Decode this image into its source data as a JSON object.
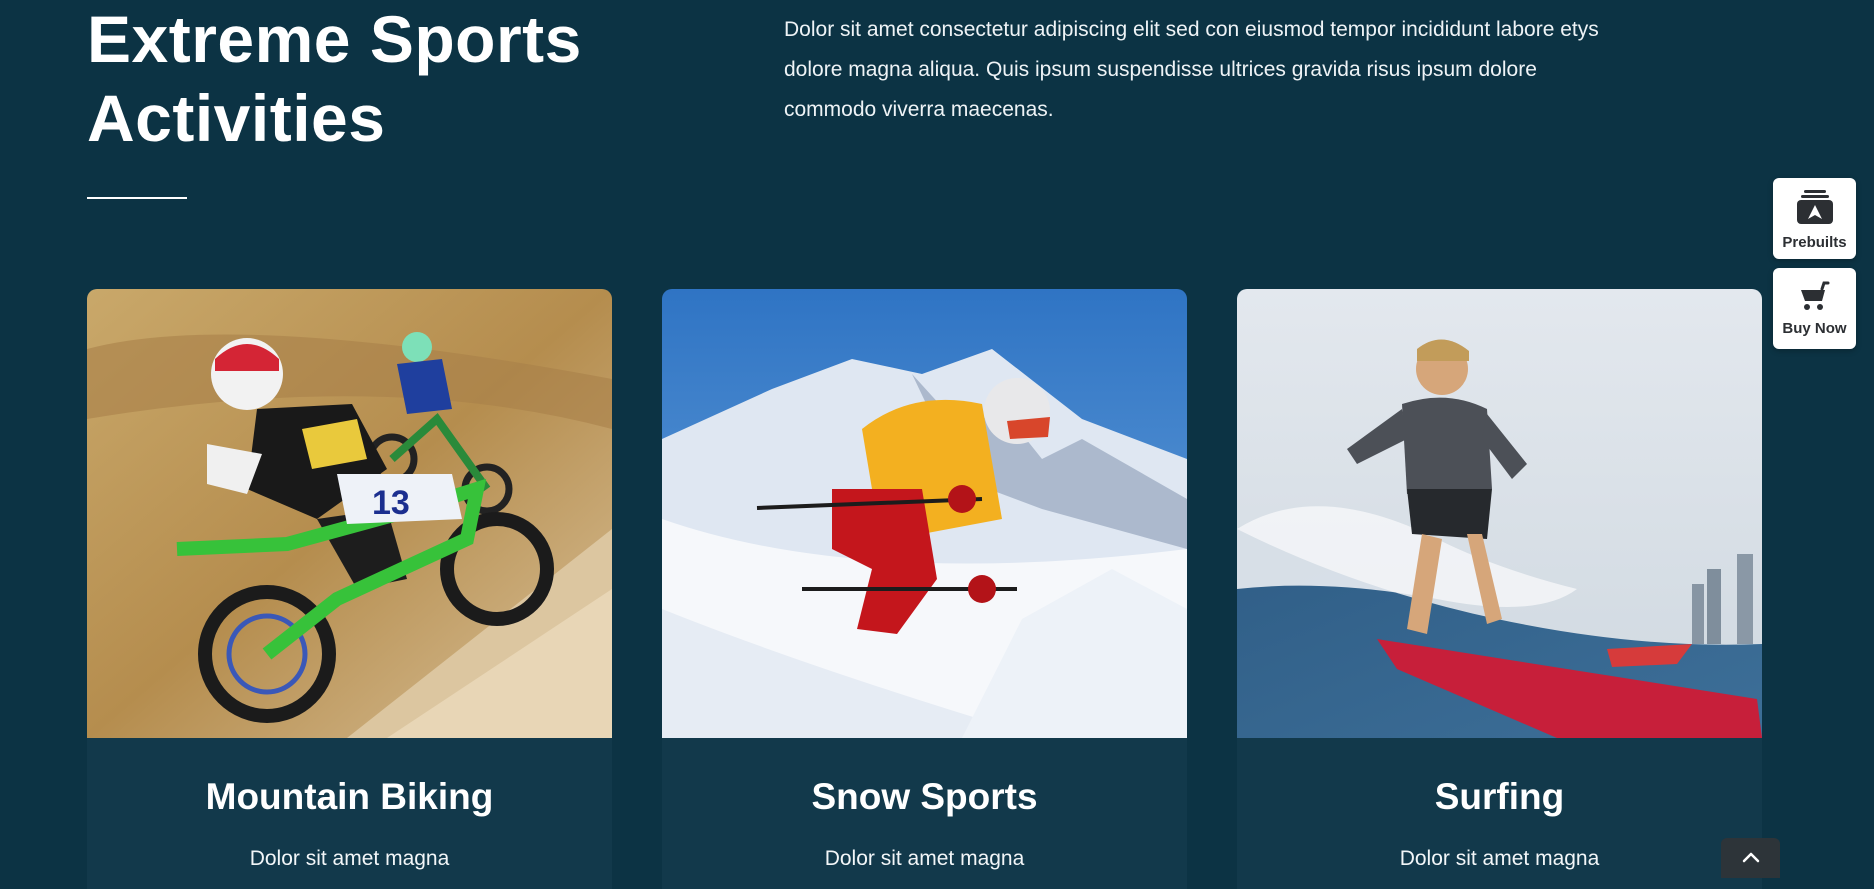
{
  "section": {
    "title_line1": "Extreme Sports",
    "title_line2": "Activities",
    "intro": "Dolor sit amet consectetur adipiscing elit sed con eiusmod tempor incididunt labore etys dolore magna aliqua. Quis ipsum suspendisse ultrices gravida risus ipsum dolore commodo viverra maecenas."
  },
  "cards": [
    {
      "title": "Mountain Biking",
      "desc": "Dolor sit amet magna"
    },
    {
      "title": "Snow Sports",
      "desc": "Dolor sit amet magna"
    },
    {
      "title": "Surfing",
      "desc": "Dolor sit amet magna"
    }
  ],
  "sidebar": {
    "prebuilts_label": "Prebuilts",
    "buynow_label": "Buy Now"
  },
  "icons": {
    "prebuilts": "stack-logo-icon",
    "buynow": "cart-icon",
    "to_top": "chevron-up-icon"
  },
  "colors": {
    "background": "#0c3344",
    "card_background": "#12394b",
    "text": "#ffffff"
  }
}
